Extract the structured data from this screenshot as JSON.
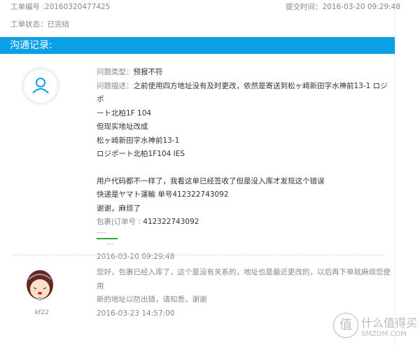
{
  "ticket": {
    "number_label": "工单编号",
    "number": "20160320477425",
    "submit_label": "提交时间",
    "submit_time": "2016-03-20 09:29:48",
    "status_label": "工单状态",
    "status": "已完结"
  },
  "section_title": "沟通记录:",
  "user_message": {
    "type_label": "问题类型",
    "type": "预报不符",
    "desc_label": "问题描述",
    "desc_lines": [
      "之前使用四方地址没有及时更改，依然是寄送到松ヶ崎新田字水神前13-1 ロジポ",
      "ート北柏1F 104",
      "但现实地址改成",
      "松ヶ崎新田字水神前13-1",
      "ロジポート北柏1F104 IES",
      "用户代码都不一样了，我看这单已经签收了但是没入库才发现这个错误",
      "快递是ヤマト運輸 单号412322743092",
      "谢谢，麻烦了"
    ],
    "order_label": "包裹|订单号",
    "order": "412322743092",
    "time": "2016-03-20 09:29:48"
  },
  "agent_message": {
    "name": "kf22",
    "lines": [
      "您好，包裹已经入库了，这个是没有关系的，地址也是最近更改的，以后再下单就麻烦您使用",
      "新的地址以防出错，请知悉，谢谢"
    ],
    "time": "2016-03-23 14:57:00"
  },
  "watermark": {
    "cn": "什么值得买",
    "en": "SMZDM.COM",
    "logo": "值"
  },
  "colors": {
    "accent": "#0aa0e6"
  }
}
